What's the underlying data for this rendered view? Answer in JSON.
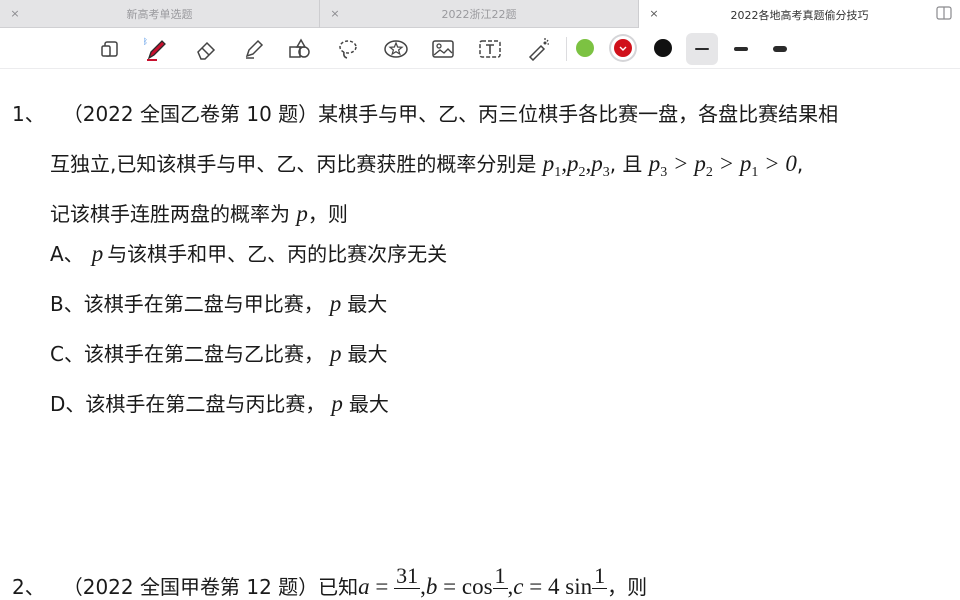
{
  "tabs": [
    {
      "label": "新高考单选题",
      "active": false
    },
    {
      "label": "2022浙江22题",
      "active": false
    },
    {
      "label": "2022各地高考真题偷分技巧",
      "active": true
    }
  ],
  "tab_close_glyph": "×",
  "toolbar": {
    "tools": [
      "lasso-select-icon",
      "pen-icon",
      "eraser-icon",
      "highlighter-icon",
      "shapes-icon",
      "lasso-icon",
      "sticker-icon",
      "image-icon",
      "text-icon",
      "laser-pointer-icon"
    ],
    "colors": [
      "#7cc242",
      "#d0111b",
      "#111111"
    ],
    "selected_color_index": 1,
    "active_stroke_index": 0
  },
  "question1": {
    "number": "1、",
    "prefix": "（2022 全国乙卷第 10 题）某棋手与甲、乙、丙三位棋手各比赛一盘，各盘比赛结果相",
    "line2_a": "互独立,已知该棋手与甲、乙、丙比赛获胜的概率分别是",
    "line2_b": ", 且",
    "line2_c": ",",
    "line3_a": "记该棋手连胜两盘的概率为",
    "line3_b": "，则",
    "var_p": "p",
    "sub1": "1",
    "sub2": "2",
    "sub3": "3",
    "comma": ",",
    "gt": " > ",
    "zero": "0",
    "options": [
      {
        "label": "A、",
        "text": "与该棋手和甲、乙、丙的比赛次序无关"
      },
      {
        "label": "B、",
        "text_before": "该棋手在第二盘与甲比赛，",
        "text_after": "最大"
      },
      {
        "label": "C、",
        "text_before": "该棋手在第二盘与乙比赛，",
        "text_after": "最大"
      },
      {
        "label": "D、",
        "text_before": "该棋手在第二盘与丙比赛，",
        "text_after": "最大"
      }
    ]
  },
  "question2": {
    "number": "2、",
    "prefix": "（2022 全国甲卷第 12 题）已知",
    "a": "a",
    "b": "b",
    "c": "c",
    "eq": " = ",
    "a_num": "31",
    "cos": "cos",
    "one": "1",
    "four_sin": "4 sin",
    "suffix": "，则"
  }
}
